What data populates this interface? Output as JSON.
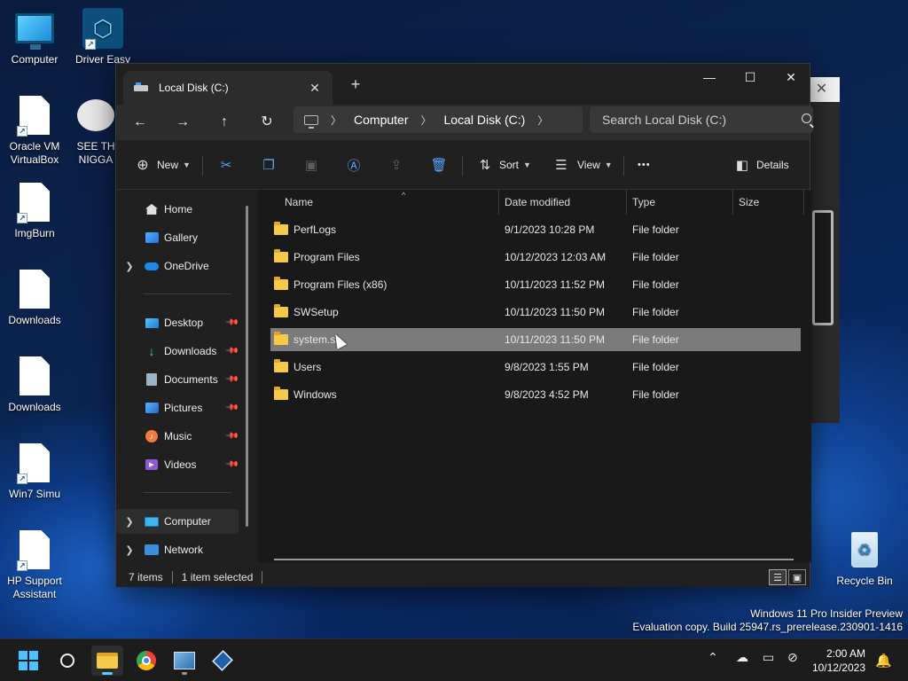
{
  "desktop": {
    "icons": [
      {
        "label": "Computer"
      },
      {
        "label": "Driver Easy"
      },
      {
        "label": "Oracle VM VirtualBox"
      },
      {
        "label": "SEE TH NIGGA"
      },
      {
        "label": "ImgBurn"
      },
      {
        "label": "Downloads"
      },
      {
        "label": "Downloads"
      },
      {
        "label": "Win7 Simu"
      },
      {
        "label": "HP Support Assistant"
      },
      {
        "label": "Recycle Bin"
      }
    ],
    "watermark": {
      "line1": "Windows 11 Pro Insider Preview",
      "line2": "Evaluation copy. Build 25947.rs_prerelease.230901-1416"
    }
  },
  "window": {
    "tab_title": "Local Disk (C:)",
    "tab_close": "✕",
    "tab_add": "+",
    "controls": {
      "minimize": "—",
      "maximize": "☐",
      "close": "✕"
    },
    "nav": {
      "back": "←",
      "forward": "→",
      "up": "↑",
      "refresh": "↻"
    },
    "breadcrumb": [
      "Computer",
      "Local Disk (C:)"
    ],
    "search_placeholder": "Search Local Disk (C:)",
    "toolbar": {
      "new_label": "New",
      "sort_label": "Sort",
      "view_label": "View",
      "more_label": "•••",
      "details_label": "Details"
    },
    "sidebar": {
      "home": "Home",
      "gallery": "Gallery",
      "onedrive": "OneDrive",
      "desktop": "Desktop",
      "downloads": "Downloads",
      "documents": "Documents",
      "pictures": "Pictures",
      "music": "Music",
      "videos": "Videos",
      "computer": "Computer",
      "network": "Network"
    },
    "columns": {
      "name": "Name",
      "date": "Date modified",
      "type": "Type",
      "size": "Size"
    },
    "files": [
      {
        "name": "PerfLogs",
        "date": "9/1/2023 10:28 PM",
        "type": "File folder"
      },
      {
        "name": "Program Files",
        "date": "10/12/2023 12:03 AM",
        "type": "File folder"
      },
      {
        "name": "Program Files (x86)",
        "date": "10/11/2023 11:52 PM",
        "type": "File folder"
      },
      {
        "name": "SWSetup",
        "date": "10/11/2023 11:50 PM",
        "type": "File folder"
      },
      {
        "name": "system.sa",
        "date": "10/11/2023 11:50 PM",
        "type": "File folder"
      },
      {
        "name": "Users",
        "date": "9/8/2023 1:55 PM",
        "type": "File folder"
      },
      {
        "name": "Windows",
        "date": "9/8/2023 4:52 PM",
        "type": "File folder"
      }
    ],
    "status": {
      "count": "7 items",
      "selected": "1 item selected"
    }
  },
  "taskbar": {
    "time": "2:00 AM",
    "date": "10/12/2023"
  }
}
